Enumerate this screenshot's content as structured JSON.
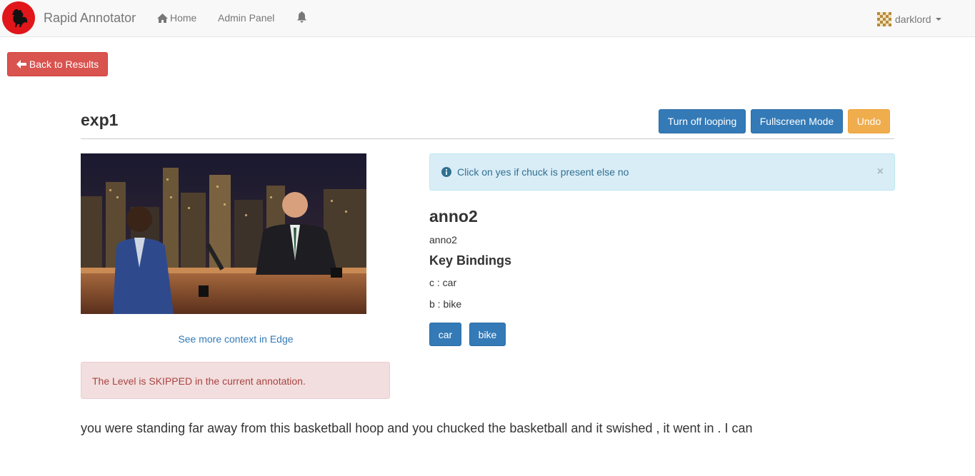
{
  "nav": {
    "brand": "Rapid Annotator",
    "home": "Home",
    "admin": "Admin Panel",
    "user": "darklord"
  },
  "page": {
    "back_label": "Back to Results",
    "title": "exp1",
    "loop_label": "Turn off looping",
    "fullscreen_label": "Fullscreen Mode",
    "undo_label": "Undo",
    "context_link": "See more context in Edge",
    "skip_alert": "The Level is SKIPPED in the current annotation.",
    "transcript": "you were standing far away from this basketball hoop and you chucked the basketball and it swished , it went in . I can"
  },
  "annotation": {
    "info": "Click on yes if chuck is present else no",
    "close": "×",
    "name": "anno2",
    "description": "anno2",
    "bindings_title": "Key Bindings",
    "bindings": [
      "c : car",
      "b : bike"
    ],
    "buttons": [
      "car",
      "bike"
    ]
  },
  "colors": {
    "danger": "#d9534f",
    "primary": "#337ab7",
    "warning": "#f0ad4e",
    "info_bg": "#d9edf7",
    "danger_bg": "#f2dede"
  }
}
